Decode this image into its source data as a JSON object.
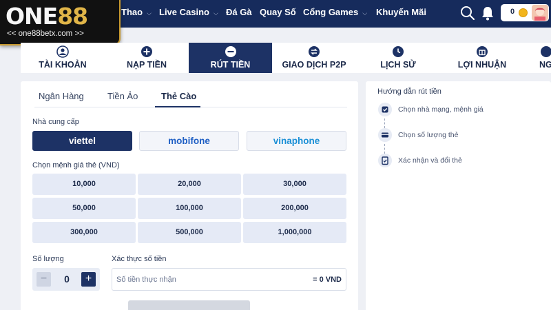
{
  "brand": {
    "name_white": "ONE",
    "name_gold": "88",
    "url": "<< one88betx.com >>"
  },
  "nav": {
    "items": [
      {
        "label": "Thao",
        "chevron": true
      },
      {
        "label": "Live Casino",
        "chevron": true
      },
      {
        "label": "Đá Gà",
        "chevron": false
      },
      {
        "label": "Quay Số",
        "chevron": false
      },
      {
        "label": "Cổng Games",
        "chevron": true
      },
      {
        "label": "Khuyến Mãi",
        "chevron": false
      }
    ],
    "balance": "0",
    "icons": [
      "search-icon",
      "bell-icon",
      "coin-icon",
      "avatar"
    ]
  },
  "tabs": [
    {
      "label": "TÀI KHOẢN",
      "icon": "user-icon"
    },
    {
      "label": "NẠP TIỀN",
      "icon": "plus-circle-icon"
    },
    {
      "label": "RÚT TIỀN",
      "icon": "minus-circle-icon",
      "active": true
    },
    {
      "label": "GIAO DỊCH P2P",
      "icon": "transfer-icon"
    },
    {
      "label": "LỊCH SỬ",
      "icon": "clock-icon"
    },
    {
      "label": "LỢI NHUẬN",
      "icon": "gift-icon"
    },
    {
      "label": "NG",
      "icon": "more-icon"
    }
  ],
  "withdraw": {
    "subtabs": [
      "Ngân Hàng",
      "Tiền Ảo",
      "Thẻ Cào"
    ],
    "active_subtab": "Thẻ Cào",
    "provider_label": "Nhà cung cấp",
    "providers": [
      {
        "label": "viettel",
        "color": "#ffffff",
        "active": true
      },
      {
        "label": "mobifone",
        "color": "#1f5fc4"
      },
      {
        "label": "vinaphone",
        "color": "#1a8fd6"
      }
    ],
    "amount_label": "Chọn mệnh giá thẻ (VND)",
    "amounts": [
      "10,000",
      "20,000",
      "30,000",
      "50,000",
      "100,000",
      "200,000",
      "300,000",
      "500,000",
      "1,000,000"
    ],
    "quantity_label": "Số lượng",
    "quantity_value": "0",
    "confirm_label": "Xác thực số tiền",
    "confirm_placeholder": "Số tiền thực nhận",
    "confirm_value": "= 0 VND"
  },
  "guide": {
    "title": "Hướng dẫn rút tiền",
    "steps": [
      "Chọn nhà mạng, mệnh giá",
      "Chọn số lượng thẻ",
      "Xác nhận và đổi thẻ"
    ]
  },
  "colors": {
    "navy": "#162b5c",
    "active": "#1d3265",
    "gold": "#e0b548",
    "tile": "#e5eaf6"
  }
}
